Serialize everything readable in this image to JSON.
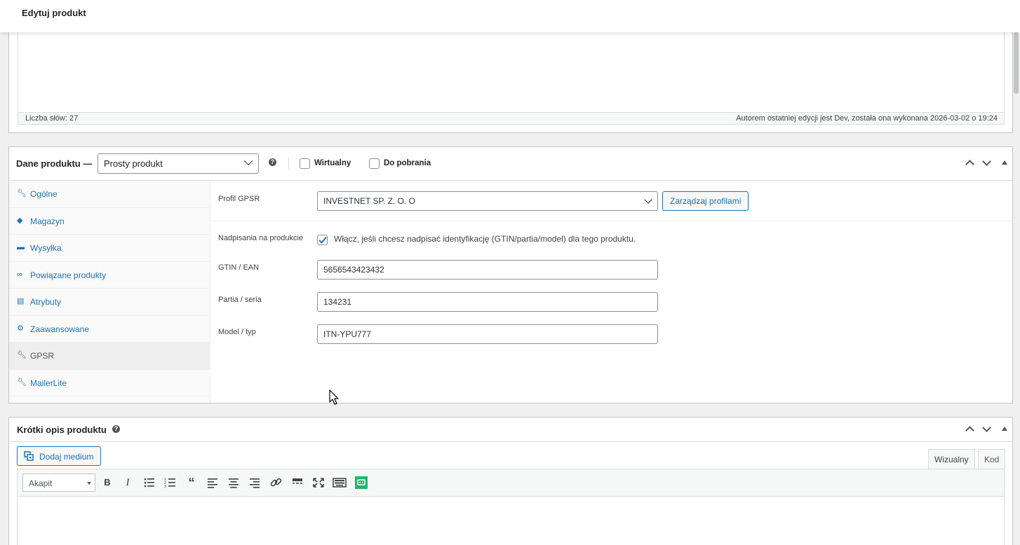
{
  "page": {
    "title": "Edytuj produkt"
  },
  "description_status": {
    "word_count": "Liczba słów: 27",
    "last_edit": "Autorem ostatniej edycji jest Dev, została ona wykonana 2026-03-02 o 19:24"
  },
  "product_data": {
    "title": "Dane produktu —",
    "type_selected": "Prosty produkt",
    "virtual_label": "Wirtualny",
    "virtual_checked": false,
    "downloadable_label": "Do pobrania",
    "downloadable_checked": false,
    "tabs": [
      {
        "label": "Ogólne",
        "icon": "wrench-icon"
      },
      {
        "label": "Magazyn",
        "icon": "tag-icon"
      },
      {
        "label": "Wysyłka",
        "icon": "truck-icon"
      },
      {
        "label": "Powiązane produkty",
        "icon": "link-icon"
      },
      {
        "label": "Atrybuty",
        "icon": "list-icon"
      },
      {
        "label": "Zaawansowane",
        "icon": "gear-icon"
      },
      {
        "label": "GPSR",
        "icon": "wrench-icon",
        "active": true
      },
      {
        "label": "MailerLite",
        "icon": "wrench-icon"
      }
    ],
    "gpsr": {
      "profile_label": "Profil GPSR",
      "profile_value": "INVESTNET SP. Z. O. O",
      "manage_button": "Zarządzaj profilami",
      "override_label": "Nadpisania na produkcie",
      "override_checked": true,
      "override_text": "Włącz, jeśli chcesz nadpisać identyfikację (GTIN/partia/model) dla tego produktu.",
      "gtin_label": "GTIN / EAN",
      "gtin_value": "5656543423432",
      "batch_label": "Partia / seria",
      "batch_value": "134231",
      "model_label": "Model / typ",
      "model_value": "ITN-YPU777"
    }
  },
  "short_description": {
    "title": "Krótki opis produktu",
    "add_media": "Dodaj medium",
    "tab_visual": "Wizualny",
    "tab_code": "Kod",
    "format_selected": "Akapit"
  },
  "colors": {
    "accent": "#2271b1",
    "border": "#c3c4c7",
    "background": "#f0f0f1",
    "active_tab": "#eeeeee",
    "toolbar_green": "#1fb86a"
  }
}
